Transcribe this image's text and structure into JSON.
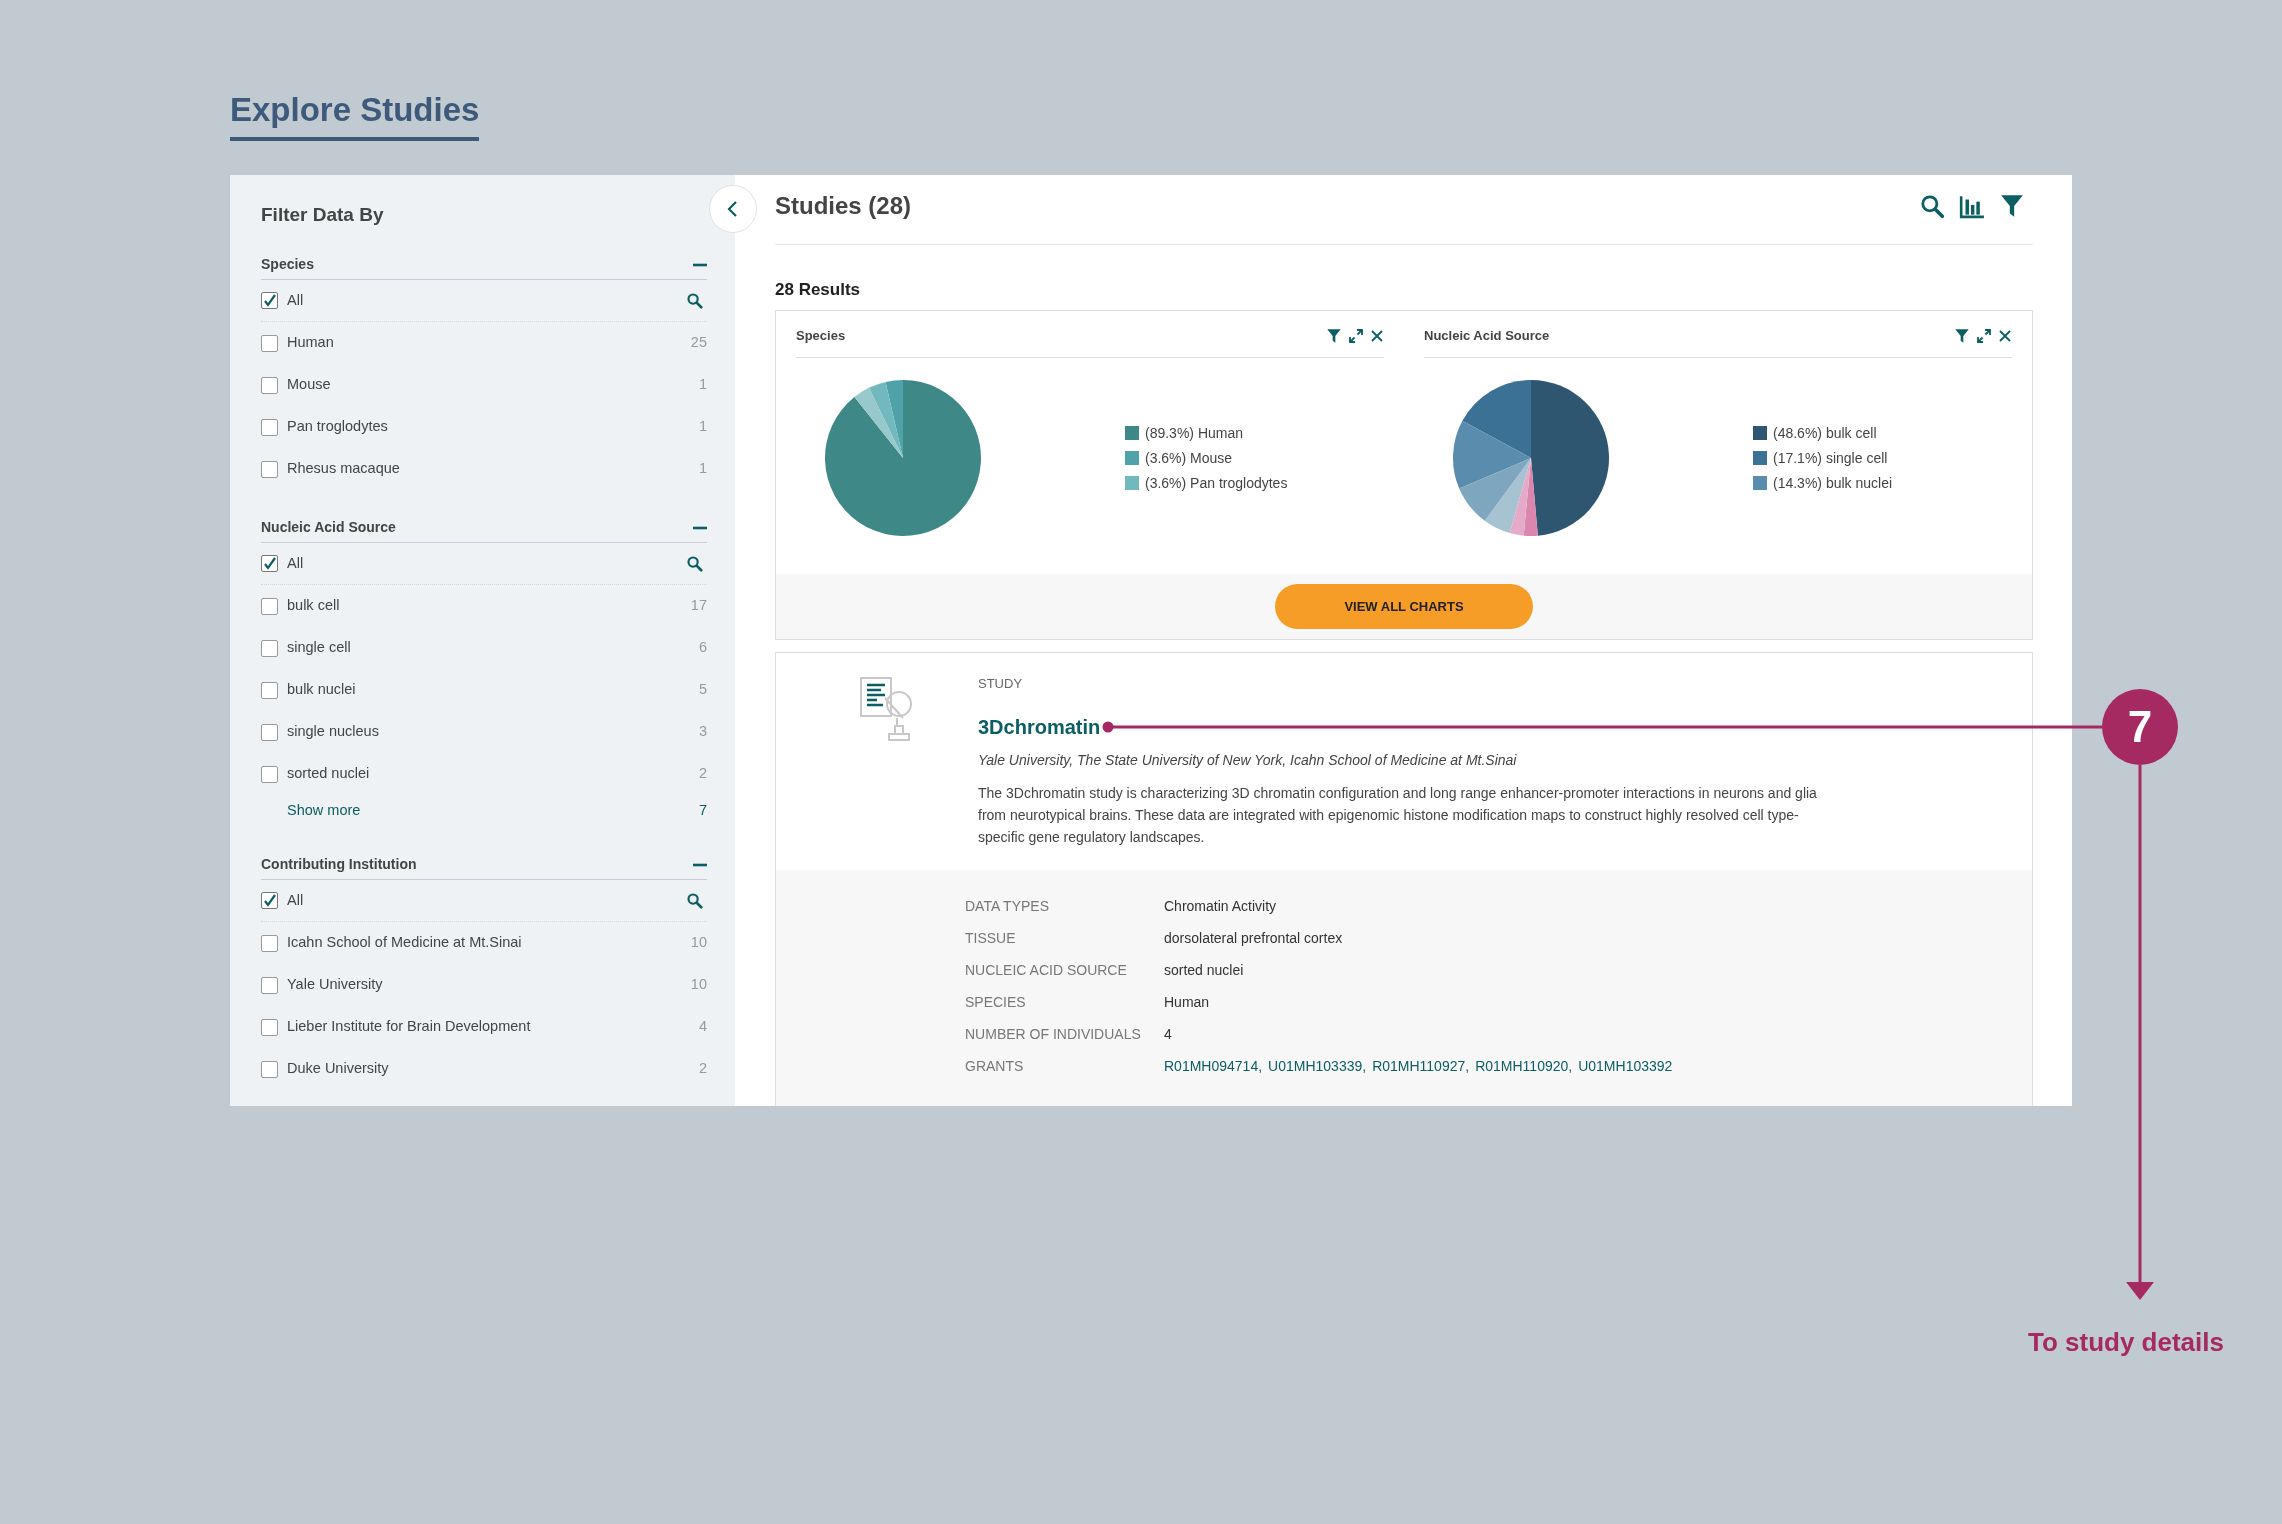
{
  "page_title": "Explore Studies",
  "sidebar": {
    "title": "Filter Data By",
    "filters": [
      {
        "name": "Species",
        "expanded": true,
        "options": [
          {
            "kind": "all",
            "label": "All",
            "checked": true
          },
          {
            "kind": "option",
            "label": "Human",
            "count": "25",
            "checked": false
          },
          {
            "kind": "option",
            "label": "Mouse",
            "count": "1",
            "checked": false
          },
          {
            "kind": "option",
            "label": "Pan troglodytes",
            "count": "1",
            "checked": false
          },
          {
            "kind": "option",
            "label": "Rhesus macaque",
            "count": "1",
            "checked": false
          }
        ]
      },
      {
        "name": "Nucleic Acid Source",
        "expanded": true,
        "options": [
          {
            "kind": "all",
            "label": "All",
            "checked": true
          },
          {
            "kind": "option",
            "label": "bulk cell",
            "count": "17",
            "checked": false
          },
          {
            "kind": "option",
            "label": "single cell",
            "count": "6",
            "checked": false
          },
          {
            "kind": "option",
            "label": "bulk nuclei",
            "count": "5",
            "checked": false
          },
          {
            "kind": "option",
            "label": "single nucleus",
            "count": "3",
            "checked": false
          },
          {
            "kind": "option",
            "label": "sorted nuclei",
            "count": "2",
            "checked": false
          }
        ],
        "show_more": {
          "label": "Show more",
          "count": "7"
        }
      },
      {
        "name": "Contributing Institution",
        "expanded": true,
        "options": [
          {
            "kind": "all",
            "label": "All",
            "checked": true
          },
          {
            "kind": "option",
            "label": "Icahn School of Medicine at Mt.Sinai",
            "count": "10",
            "checked": false
          },
          {
            "kind": "option",
            "label": "Yale University",
            "count": "10",
            "checked": false
          },
          {
            "kind": "option",
            "label": "Lieber Institute for Brain Development",
            "count": "4",
            "checked": false
          },
          {
            "kind": "option",
            "label": "Duke University",
            "count": "2",
            "checked": false
          }
        ]
      }
    ]
  },
  "main": {
    "title": "Studies (28)",
    "results": "28 Results",
    "charts": [
      {
        "title": "Species",
        "chart_data": {
          "type": "pie",
          "categories": [
            "Human",
            "Mouse",
            "Pan troglodytes",
            null
          ],
          "values": [
            89.3,
            3.6,
            3.6,
            3.5
          ],
          "colors": [
            "#3e8888",
            "#4fa3a8",
            "#72b9bd",
            "#97c9cc"
          ]
        },
        "legend": [
          "(89.3%)",
          "(3.6%)",
          "(3.6%)"
        ]
      },
      {
        "title": "Nucleic Acid Source",
        "chart_data": {
          "type": "pie",
          "categories": [
            "bulk cell",
            "single cell",
            "bulk nuclei",
            null,
            null,
            null,
            null
          ],
          "values": [
            48.6,
            17.1,
            14.3,
            2.9,
            2.9,
            5.7,
            8.5
          ],
          "colors": [
            "#2e5670",
            "#3a7194",
            "#5a8cad",
            "#dc86ad",
            "#e5aac8",
            "#a7c2d1",
            "#7ea6bf"
          ]
        },
        "legend": [
          "(48.6%)",
          "(17.1%)",
          "(14.3%)"
        ]
      }
    ],
    "view_all_button": "VIEW ALL CHARTS"
  },
  "study": {
    "label": "STUDY",
    "title": "3Dchromatin",
    "institutions": "Yale University, The State University of New York, Icahn School of Medicine at Mt.Sinai",
    "description": "The 3Dchromatin study is characterizing 3D chromatin configuration and long range enhancer-promoter interactions in neurons and glia from neurotypical brains. These data are integrated with epigenomic histone modification maps to construct highly resolved cell type-specific gene regulatory landscapes.",
    "details": [
      {
        "label": "DATA TYPES",
        "value": "Chromatin Activity"
      },
      {
        "label": "TISSUE",
        "value": "dorsolateral prefrontal cortex"
      },
      {
        "label": "NUCLEIC ACID SOURCE",
        "value": "sorted nuclei"
      },
      {
        "label": "SPECIES",
        "value": "Human"
      },
      {
        "label": "NUMBER OF INDIVIDUALS",
        "value": "4"
      },
      {
        "label": "GRANTS",
        "links": [
          "R01MH094714,",
          "U01MH103339,",
          "R01MH110927,",
          "R01MH110920,",
          "U01MH103392"
        ]
      }
    ]
  },
  "annotation": {
    "number": "7",
    "caption": "To study details"
  }
}
